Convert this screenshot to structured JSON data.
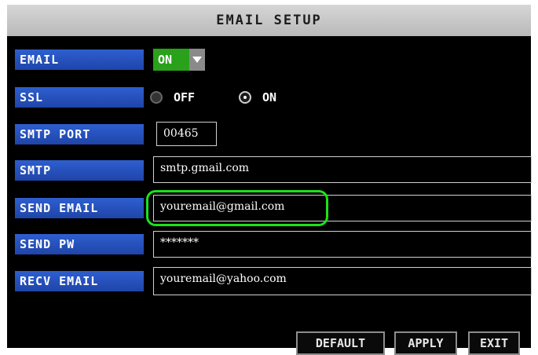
{
  "window": {
    "title": "EMAIL SETUP"
  },
  "labels": {
    "email": "EMAIL",
    "ssl": "SSL",
    "smtp_port": "SMTP PORT",
    "smtp": "SMTP",
    "send_email": "SEND EMAIL",
    "send_pw": "SEND PW",
    "recv_email": "RECV EMAIL"
  },
  "email_select": {
    "value": "ON",
    "icon": "chevron-down-icon"
  },
  "ssl_radio": {
    "off_label": "OFF",
    "on_label": "ON",
    "selected": "ON"
  },
  "fields": {
    "smtp_port": "00465",
    "smtp": "smtp.gmail.com",
    "send_email": "youremail@gmail.com",
    "send_pw": "*******",
    "recv_email": "youremail@yahoo.com"
  },
  "buttons": {
    "default": "DEFAULT",
    "apply": "APPLY",
    "exit": "EXIT"
  },
  "colors": {
    "label_bg": "#2559c4",
    "select_bg": "#2aa11a",
    "highlight": "#19e31b"
  }
}
